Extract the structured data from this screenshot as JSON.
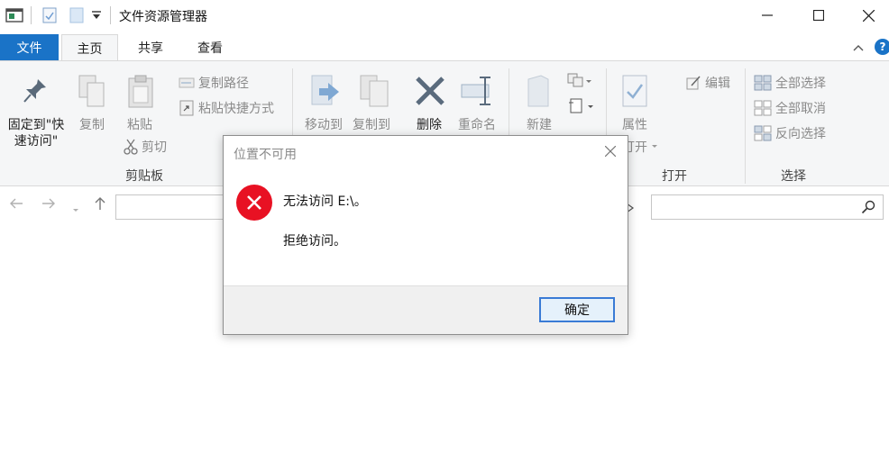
{
  "window": {
    "title": "文件资源管理器",
    "minimize_icon": "minimize-icon",
    "maximize_icon": "maximize-icon",
    "close_icon": "close-icon"
  },
  "tabs": {
    "file": "文件",
    "home": "主页",
    "share": "共享",
    "view": "查看"
  },
  "ribbon": {
    "pin": {
      "line1": "固定到\"快",
      "line2": "速访问\""
    },
    "copy": "复制",
    "paste": "粘贴",
    "copy_path": "复制路径",
    "paste_shortcut": "粘贴快捷方式",
    "cut": "剪切",
    "clipboard_group": "剪贴板",
    "move_to": "移动到",
    "copy_to": "复制到",
    "delete": "删除",
    "rename": "重命名",
    "new": "新建",
    "properties": "属性",
    "edit": "编辑",
    "open": "打开",
    "open_group": "打开",
    "select_all": "全部选择",
    "select_none": "全部取消",
    "invert_selection": "反向选择",
    "select_group": "选择"
  },
  "dialog": {
    "title": "位置不可用",
    "message": "无法访问 E:\\。",
    "detail": "拒绝访问。",
    "ok_label": "确定"
  },
  "colors": {
    "accent": "#1a73c7",
    "error": "#e81123"
  }
}
